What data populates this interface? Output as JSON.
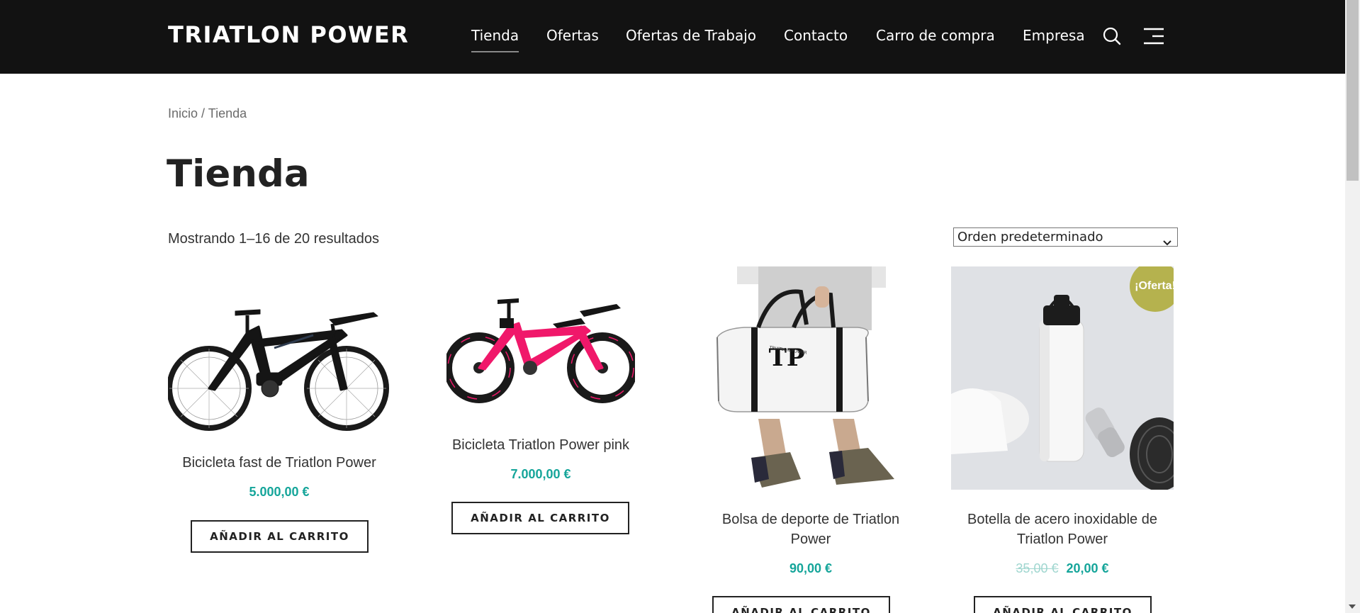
{
  "header": {
    "logo": "TRIATLON POWER",
    "nav": [
      {
        "label": "Tienda",
        "active": true
      },
      {
        "label": "Ofertas"
      },
      {
        "label": "Ofertas de Trabajo"
      },
      {
        "label": "Contacto"
      },
      {
        "label": "Carro de compra"
      },
      {
        "label": "Empresa"
      }
    ],
    "icons": [
      "search-icon",
      "menu-icon"
    ]
  },
  "breadcrumb": {
    "home": "Inicio",
    "separator": "/",
    "current": "Tienda"
  },
  "page": {
    "title": "Tienda",
    "result_count": "Mostrando 1–16 de 20 resultados"
  },
  "sort": {
    "selected": "Orden predeterminado"
  },
  "products": [
    {
      "title": "Bicicleta fast de Triatlon Power",
      "price": "5.000,00 €",
      "button": "AÑADIR AL CARRITO"
    },
    {
      "title": "Bicicleta Triatlon Power pink",
      "price": "7.000,00 €",
      "button": "AÑADIR AL CARRITO"
    },
    {
      "title_line1": "Bolsa de deporte de Triatlon",
      "title_line2": "Power",
      "price": "90,00 €",
      "button": "AÑADIR AL CARRITO"
    },
    {
      "title_line1": "Botella de acero inoxidable de",
      "title_line2": "Triatlon Power",
      "old_price": "35,00 €",
      "price": "20,00 €",
      "badge": "¡Oferta!",
      "button": "AÑADIR AL CARRITO"
    }
  ],
  "bag_print": {
    "monogram": "TP",
    "text": "TRIATLON POWER"
  },
  "colors": {
    "header_bg": "#121212",
    "price": "#15a59a",
    "badge": "#b5b24e",
    "bike_pink": "#f0186a"
  }
}
